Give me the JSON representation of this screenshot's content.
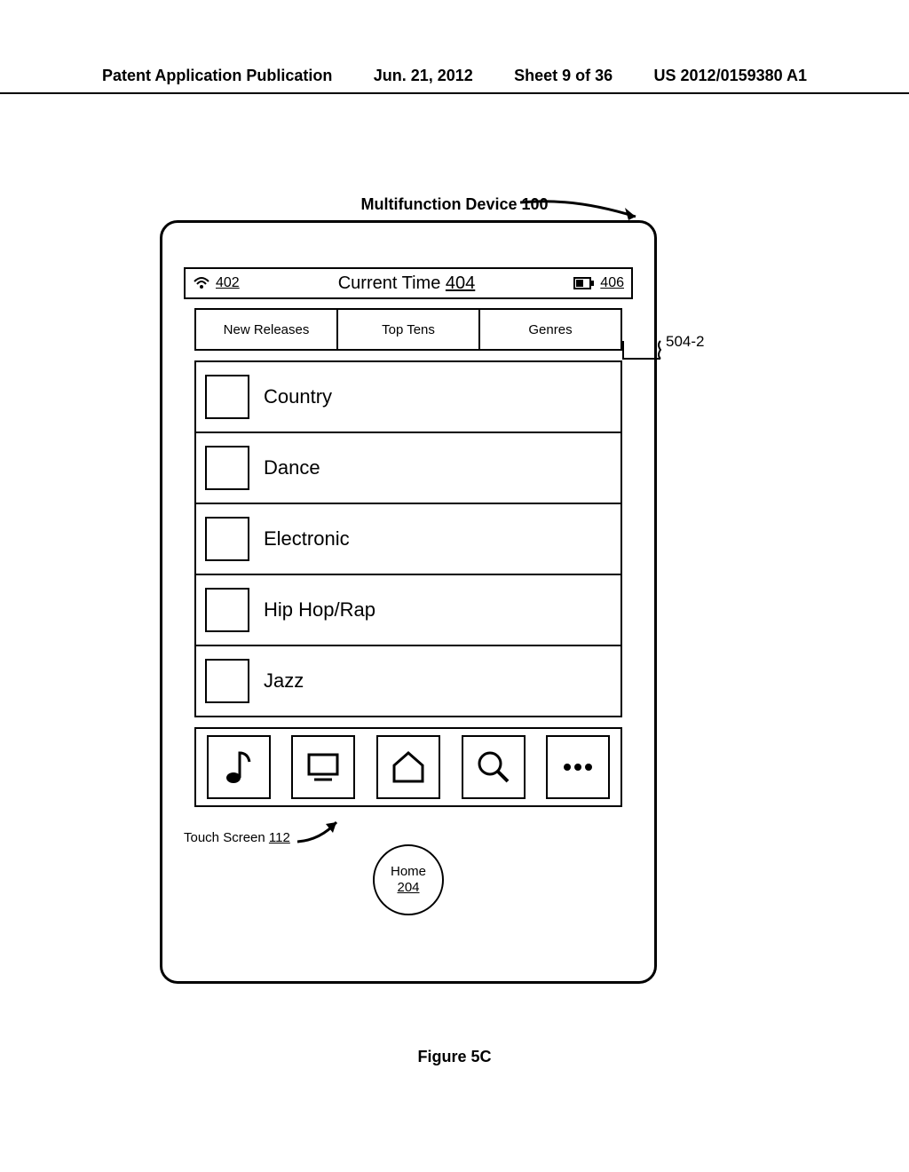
{
  "header": {
    "left": "Patent Application Publication",
    "date": "Jun. 21, 2012",
    "sheet": "Sheet 9 of 36",
    "right": "US 2012/0159380 A1"
  },
  "device_label": "Multifunction Device 100",
  "status": {
    "sig_ref": "402",
    "time_label": "Current Time",
    "time_ref": "404",
    "batt_ref": "406"
  },
  "tabs": [
    "New Releases",
    "Top Tens",
    "Genres"
  ],
  "genres": [
    "Country",
    "Dance",
    "Electronic",
    "Hip Hop/Rap",
    "Jazz"
  ],
  "callout_tab": "504-2",
  "touch_label_text": "Touch Screen",
  "touch_ref": "112",
  "home_label": "Home",
  "home_ref": "204",
  "figure": "Figure 5C"
}
